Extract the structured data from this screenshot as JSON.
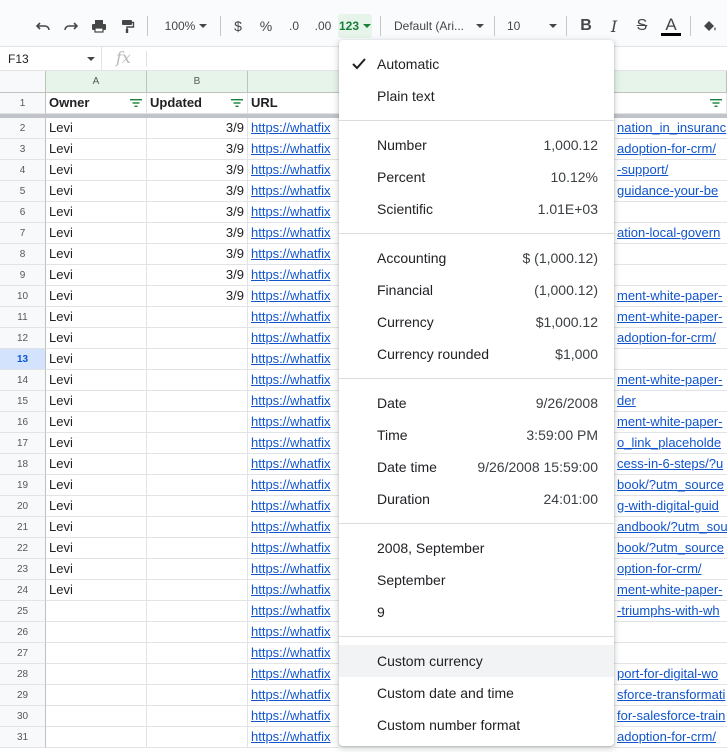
{
  "toolbar": {
    "zoom": "100%",
    "currency_symbol": "$",
    "percent_symbol": "%",
    "decrease_decimals": ".0",
    "increase_decimals": ".00",
    "more_formats": "123",
    "font_family": "Default (Ari...",
    "font_size": "10",
    "bold": "B",
    "italic": "I",
    "strikethrough": "S",
    "text_color": "A"
  },
  "formula_bar": {
    "cell_ref": "F13",
    "fx": "fx"
  },
  "columns": [
    {
      "letter": "A"
    },
    {
      "letter": "B"
    }
  ],
  "header_row": {
    "num": "1",
    "owner": "Owner",
    "updated": "Updated",
    "url": "URL"
  },
  "rows": [
    {
      "num": "2",
      "owner": "Levi",
      "updated": "3/9",
      "url": "https://whatfix",
      "right": "nation_in_insuranc"
    },
    {
      "num": "3",
      "owner": "Levi",
      "updated": "3/9",
      "url": "https://whatfix",
      "right": "adoption-for-crm/"
    },
    {
      "num": "4",
      "owner": "Levi",
      "updated": "3/9",
      "url": "https://whatfix",
      "right": "-support/"
    },
    {
      "num": "5",
      "owner": "Levi",
      "updated": "3/9",
      "url": "https://whatfix",
      "right": "guidance-your-be"
    },
    {
      "num": "6",
      "owner": "Levi",
      "updated": "3/9",
      "url": "https://whatfix",
      "right": ""
    },
    {
      "num": "7",
      "owner": "Levi",
      "updated": "3/9",
      "url": "https://whatfix",
      "right": "ation-local-govern"
    },
    {
      "num": "8",
      "owner": "Levi",
      "updated": "3/9",
      "url": "https://whatfix",
      "right": ""
    },
    {
      "num": "9",
      "owner": "Levi",
      "updated": "3/9",
      "url": "https://whatfix",
      "right": ""
    },
    {
      "num": "10",
      "owner": "Levi",
      "updated": "3/9",
      "url": "https://whatfix",
      "right": "ment-white-paper-"
    },
    {
      "num": "11",
      "owner": "Levi",
      "updated": "",
      "url": "https://whatfix",
      "right": "ment-white-paper-"
    },
    {
      "num": "12",
      "owner": "Levi",
      "updated": "",
      "url": "https://whatfix",
      "right": "adoption-for-crm/"
    },
    {
      "num": "13",
      "owner": "Levi",
      "updated": "",
      "url": "https://whatfix",
      "right": ""
    },
    {
      "num": "14",
      "owner": "Levi",
      "updated": "",
      "url": "https://whatfix",
      "right": "ment-white-paper-"
    },
    {
      "num": "15",
      "owner": "Levi",
      "updated": "",
      "url": "https://whatfix",
      "right": "der"
    },
    {
      "num": "16",
      "owner": "Levi",
      "updated": "",
      "url": "https://whatfix",
      "right": "ment-white-paper-"
    },
    {
      "num": "17",
      "owner": "Levi",
      "updated": "",
      "url": "https://whatfix",
      "right": "o_link_placeholde"
    },
    {
      "num": "18",
      "owner": "Levi",
      "updated": "",
      "url": "https://whatfix",
      "right": "cess-in-6-steps/?u"
    },
    {
      "num": "19",
      "owner": "Levi",
      "updated": "",
      "url": "https://whatfix",
      "right": "book/?utm_source"
    },
    {
      "num": "20",
      "owner": "Levi",
      "updated": "",
      "url": "https://whatfix",
      "right": "g-with-digital-guid"
    },
    {
      "num": "21",
      "owner": "Levi",
      "updated": "",
      "url": "https://whatfix",
      "right": "andbook/?utm_sou"
    },
    {
      "num": "22",
      "owner": "Levi",
      "updated": "",
      "url": "https://whatfix",
      "right": "book/?utm_source"
    },
    {
      "num": "23",
      "owner": "Levi",
      "updated": "",
      "url": "https://whatfix",
      "right": "option-for-crm/"
    },
    {
      "num": "24",
      "owner": "Levi",
      "updated": "",
      "url": "https://whatfix",
      "right": "ment-white-paper-"
    },
    {
      "num": "25",
      "owner": "",
      "updated": "",
      "url": "https://whatfix",
      "right": "-triumphs-with-wh"
    },
    {
      "num": "26",
      "owner": "",
      "updated": "",
      "url": "https://whatfix",
      "right": ""
    },
    {
      "num": "27",
      "owner": "",
      "updated": "",
      "url": "https://whatfix",
      "right": ""
    },
    {
      "num": "28",
      "owner": "",
      "updated": "",
      "url": "https://whatfix",
      "right": "port-for-digital-wo"
    },
    {
      "num": "29",
      "owner": "",
      "updated": "",
      "url": "https://whatfix",
      "right": "sforce-transformati"
    },
    {
      "num": "30",
      "owner": "",
      "updated": "",
      "url": "https://whatfix",
      "right": "for-salesforce-train"
    },
    {
      "num": "31",
      "owner": "",
      "updated": "",
      "url": "https://whatfix",
      "right": "adoption-for-crm/"
    }
  ],
  "menu": {
    "groups": [
      [
        {
          "label": "Automatic",
          "sample": "",
          "checked": true
        },
        {
          "label": "Plain text",
          "sample": ""
        }
      ],
      [
        {
          "label": "Number",
          "sample": "1,000.12"
        },
        {
          "label": "Percent",
          "sample": "10.12%"
        },
        {
          "label": "Scientific",
          "sample": "1.01E+03"
        }
      ],
      [
        {
          "label": "Accounting",
          "sample": "$ (1,000.12)"
        },
        {
          "label": "Financial",
          "sample": "(1,000.12)"
        },
        {
          "label": "Currency",
          "sample": "$1,000.12"
        },
        {
          "label": "Currency rounded",
          "sample": "$1,000"
        }
      ],
      [
        {
          "label": "Date",
          "sample": "9/26/2008"
        },
        {
          "label": "Time",
          "sample": "3:59:00 PM"
        },
        {
          "label": "Date time",
          "sample": "9/26/2008 15:59:00"
        },
        {
          "label": "Duration",
          "sample": "24:01:00"
        }
      ],
      [
        {
          "label": "2008, September",
          "sample": ""
        },
        {
          "label": "September",
          "sample": ""
        },
        {
          "label": "9",
          "sample": ""
        }
      ],
      [
        {
          "label": "Custom currency",
          "sample": "",
          "hover": true
        },
        {
          "label": "Custom date and time",
          "sample": ""
        },
        {
          "label": "Custom number format",
          "sample": ""
        }
      ]
    ]
  },
  "selected_row": "13",
  "colors": {
    "accent_green": "#188038",
    "link_blue": "#1155cc",
    "selected_row_bg": "#d3e3fd"
  }
}
